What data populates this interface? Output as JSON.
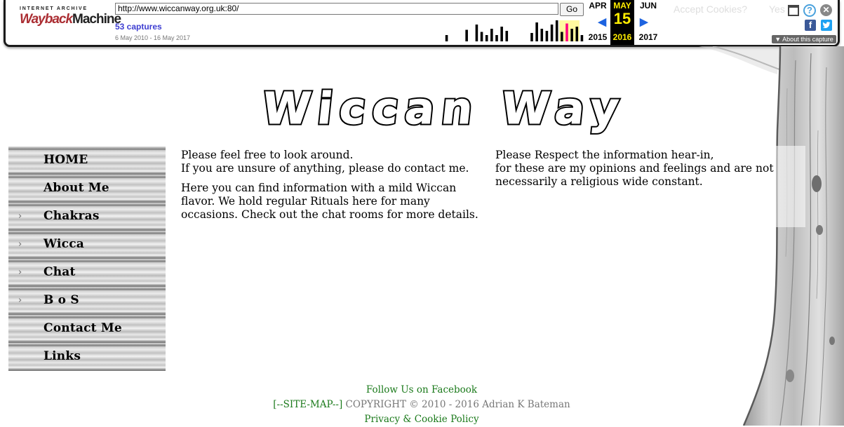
{
  "wayback": {
    "logo_top": "INTERNET ARCHIVE",
    "logo_way": "Wayback",
    "logo_machine": "Machine",
    "url_value": "http://www.wiccanway.org.uk:80/",
    "go_label": "Go",
    "captures_label": "53 captures",
    "capture_range": "6 May 2010 - 16 May 2017",
    "calendar": {
      "prev": {
        "month": "APR",
        "year": "2015"
      },
      "current": {
        "month": "MAY",
        "day": "15",
        "year": "2016"
      },
      "next": {
        "month": "JUN",
        "year": "2017"
      }
    },
    "about_label": "▼ About this capture",
    "ghost_text": "Accept Cookies?",
    "ghost_text_2": "Yes",
    "sparkline_heights": [
      0.3,
      0,
      0,
      0,
      0.55,
      0,
      0.8,
      0.45,
      0.3,
      0.6,
      0.3,
      0.7,
      0.5,
      0,
      0,
      0,
      0,
      0.4,
      0.9,
      0.6,
      0.5,
      0.8,
      1.0,
      0.45,
      0.85,
      0.6,
      0.7,
      0.3
    ],
    "sparkline_highlight_index": 24,
    "colors": {
      "sparkline_bar": "#000000",
      "sparkline_highlight_bg": "#fffaa0",
      "current_bg": "#000000",
      "current_text": "#ffed00",
      "highlight_bar": "#ff0080"
    }
  },
  "site": {
    "title": "Wiccan Way"
  },
  "nav": {
    "items": [
      {
        "label": "HOME",
        "arrow": false
      },
      {
        "label": "About Me",
        "arrow": false
      },
      {
        "label": "Chakras",
        "arrow": true
      },
      {
        "label": "Wicca",
        "arrow": true
      },
      {
        "label": "Chat",
        "arrow": true
      },
      {
        "label": "B o S",
        "arrow": true
      },
      {
        "label": "Contact Me",
        "arrow": false
      },
      {
        "label": "Links",
        "arrow": false
      }
    ],
    "arrow_glyph": "›"
  },
  "content": {
    "left": {
      "line1": "Please feel free to look around.",
      "line2": "If you are unsure of anything, please do contact me.",
      "paragraph2": "Here you can find information with a mild Wiccan flavor. We hold regular Rituals here for many occasions. Check out the chat rooms for more details."
    },
    "right": {
      "line1": "Please Respect the information hear-in,",
      "line2": "for these are my opinions and feelings and are not necessarily a religious wide constant."
    }
  },
  "footer": {
    "facebook": "Follow Us on Facebook",
    "sitemap": "[--SITE-MAP--]",
    "copyright": " COPYRIGHT © 2010 - 2016 Adrian K Bateman",
    "privacy": "Privacy & Cookie Policy"
  }
}
